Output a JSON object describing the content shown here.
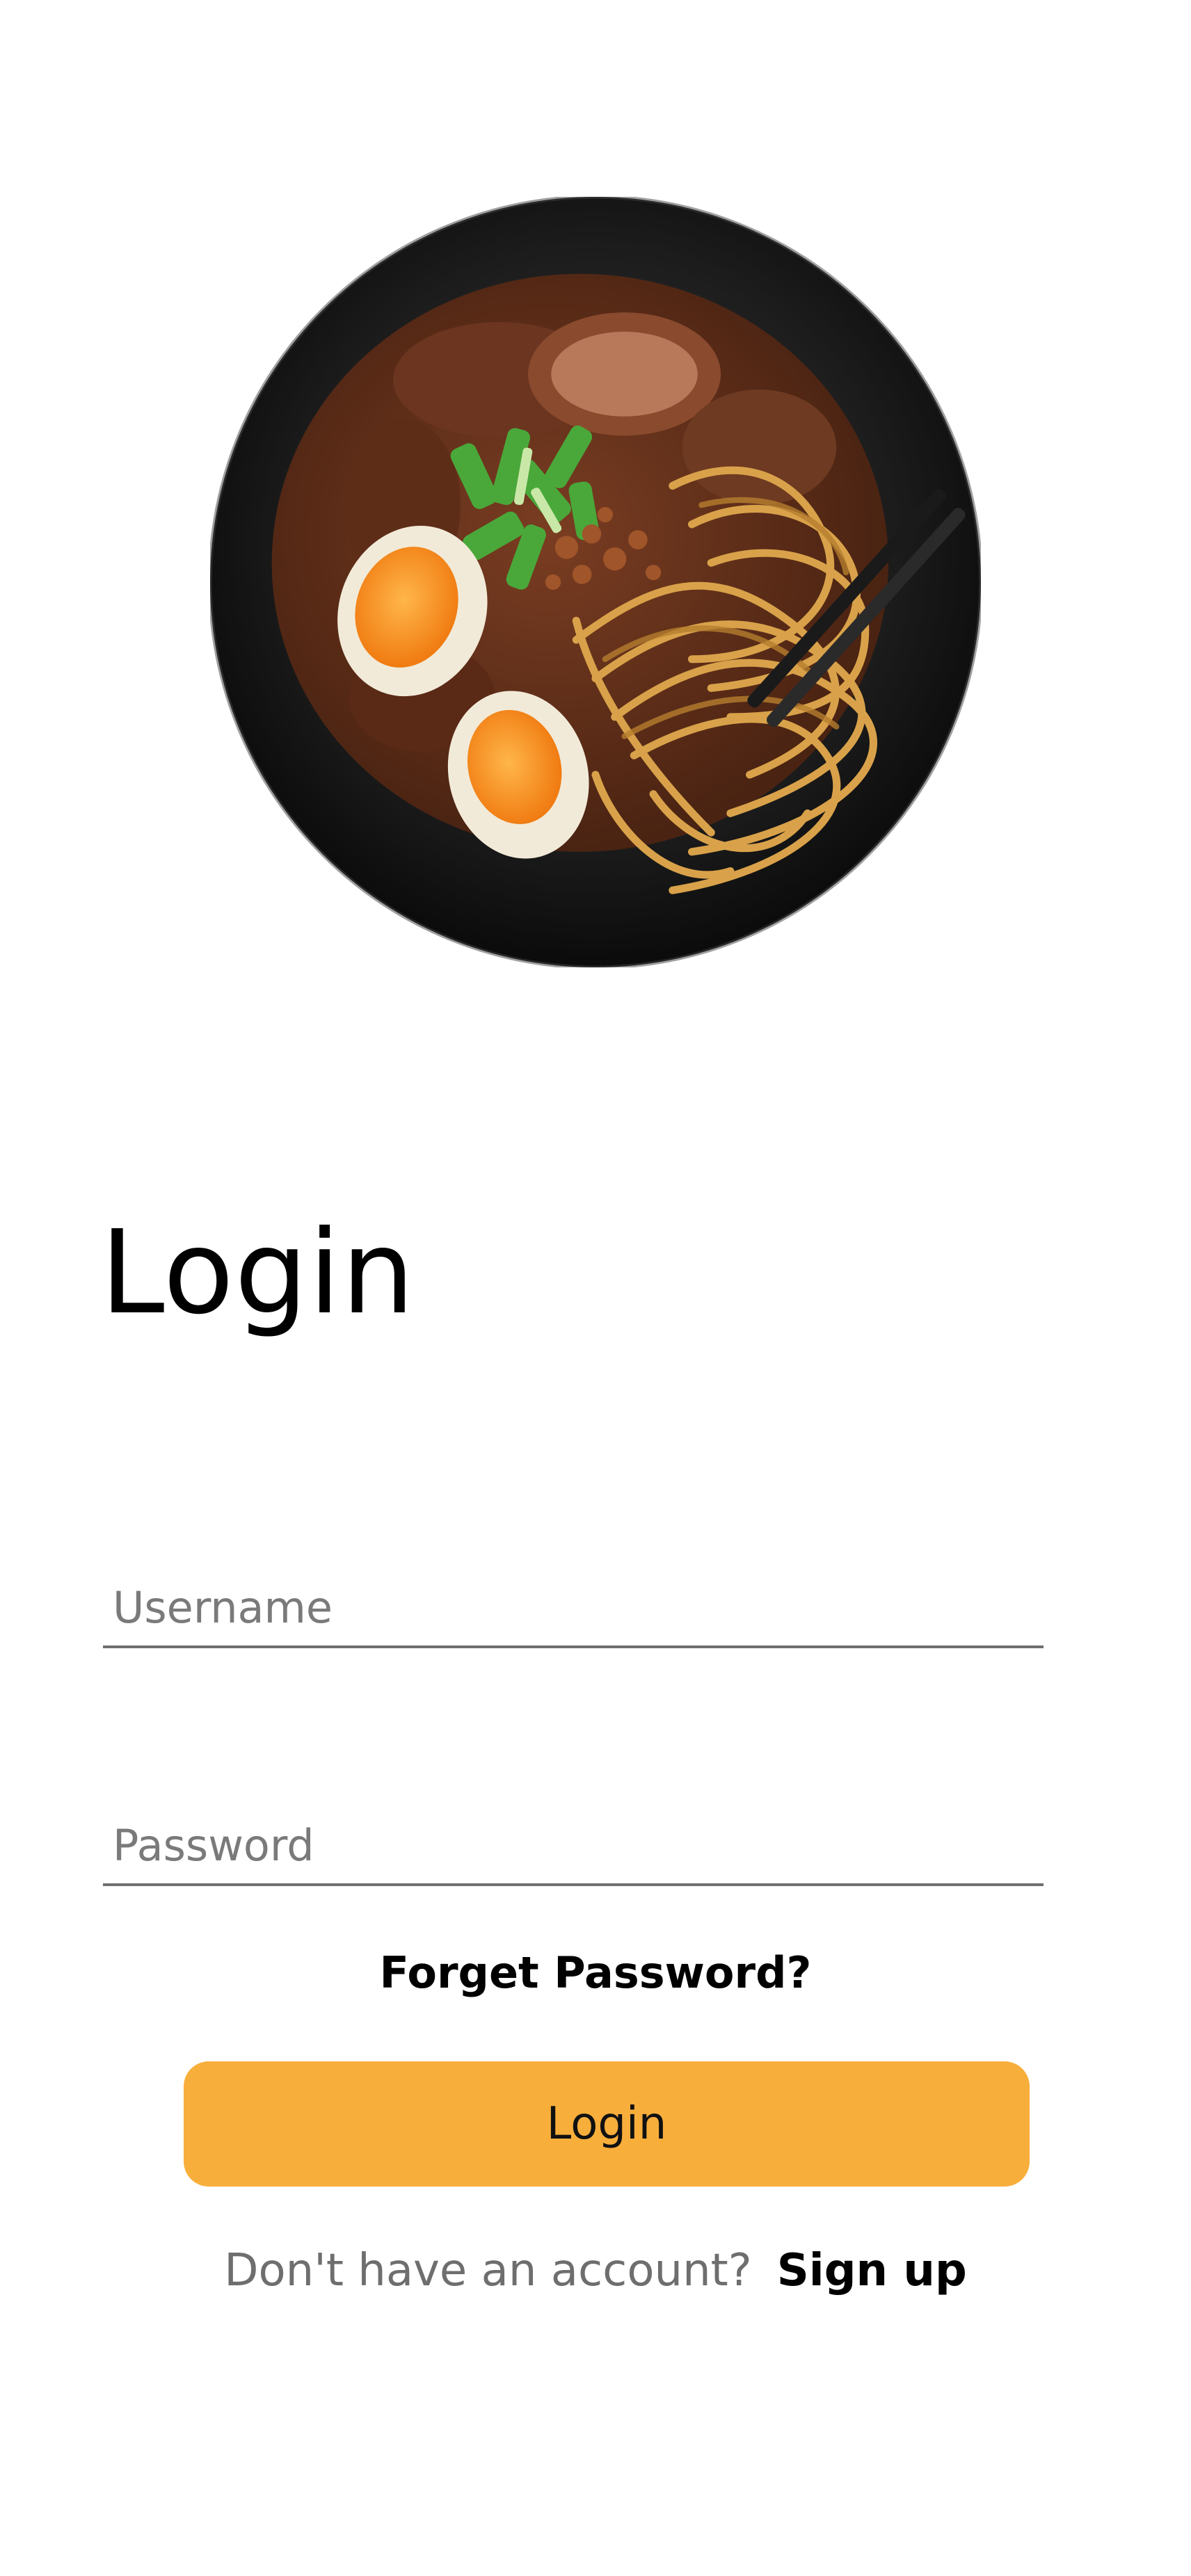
{
  "hero": {
    "image": "ramen-bowl-illustration"
  },
  "title": "Login",
  "form": {
    "username_placeholder": "Username",
    "username_value": "",
    "password_placeholder": "Password",
    "password_value": ""
  },
  "forgot_password_label": "Forget Password?",
  "login_button_label": "Login",
  "signup": {
    "prompt": "Don't have an account?",
    "link_label": "Sign up"
  },
  "colors": {
    "accent": "#f8ae3b",
    "background": "#ffffff",
    "text": "#000000",
    "muted_text": "#6e6e6e",
    "underline": "#6f6f6f"
  }
}
